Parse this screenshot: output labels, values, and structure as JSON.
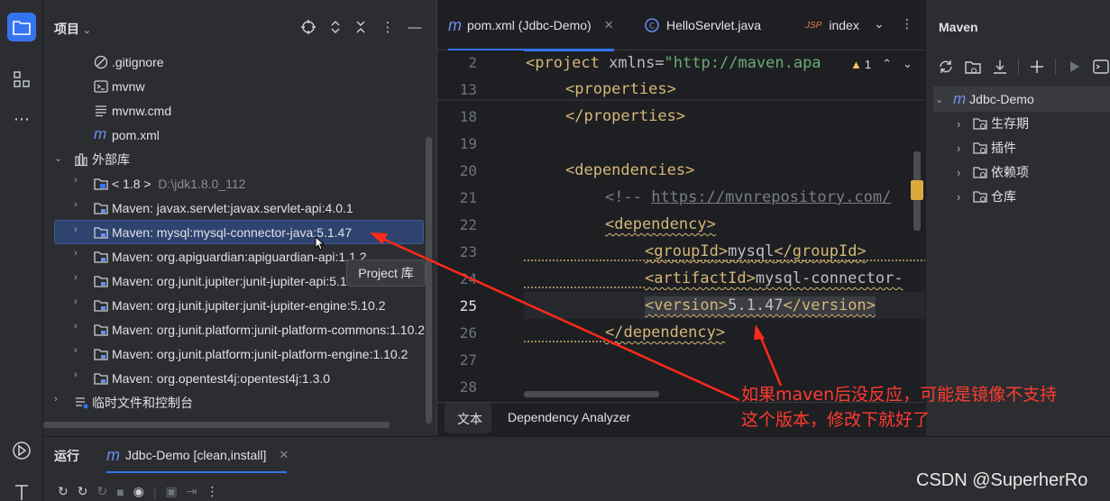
{
  "project_panel": {
    "title": "项目",
    "tree": [
      {
        "label": ".gitignore",
        "icon": "ignore-file-icon"
      },
      {
        "label": "mvnw",
        "icon": "terminal-file-icon"
      },
      {
        "label": "mvnw.cmd",
        "icon": "text-file-icon"
      },
      {
        "label": "pom.xml",
        "icon": "maven-file-icon"
      },
      {
        "label": "外部库",
        "icon": "library-icon"
      },
      {
        "label": "< 1.8 >",
        "path": "D:\\jdk1.8.0_112",
        "icon": "jdk-icon"
      },
      {
        "label": "Maven: javax.servlet:javax.servlet-api:4.0.1",
        "icon": "library-folder-icon"
      },
      {
        "label": "Maven: mysql:mysql-connector-java:5.1.47",
        "icon": "library-folder-icon"
      },
      {
        "label": "Maven: org.apiguardian:apiguardian-api:1.1.2",
        "icon": "library-folder-icon"
      },
      {
        "label": "Maven: org.junit.jupiter:junit-jupiter-api:5.10.2",
        "icon": "library-folder-icon"
      },
      {
        "label": "Maven: org.junit.jupiter:junit-jupiter-engine:5.10.2",
        "icon": "library-folder-icon"
      },
      {
        "label": "Maven: org.junit.platform:junit-platform-commons:1.10.2",
        "icon": "library-folder-icon"
      },
      {
        "label": "Maven: org.junit.platform:junit-platform-engine:1.10.2",
        "icon": "library-folder-icon"
      },
      {
        "label": "Maven: org.opentest4j:opentest4j:1.3.0",
        "icon": "library-folder-icon"
      },
      {
        "label": "临时文件和控制台",
        "icon": "scratches-icon"
      }
    ],
    "tooltip": "Project 库"
  },
  "editor": {
    "tabs": [
      {
        "label": "pom.xml (Jdbc-Demo)",
        "icon": "maven-file-icon"
      },
      {
        "label": "HelloServlet.java",
        "icon": "java-class-icon"
      },
      {
        "label": "index",
        "icon": "jsp-file-icon"
      }
    ],
    "warning_count": "1",
    "line_numbers": [
      "2",
      "13",
      "18",
      "19",
      "20",
      "21",
      "22",
      "23",
      "24",
      "25",
      "26",
      "27",
      "28"
    ],
    "code": {
      "l2_open": "<project ",
      "l2_attr": "xmlns=",
      "l2_str": "\"http://maven.apa",
      "l13": "<properties>",
      "l18": "</properties>",
      "l20": "<dependencies>",
      "l21_a": "<!-- ",
      "l21_b": "https://mvnrepository.com/",
      "l22": "<dependency>",
      "l23_a": "<groupId>",
      "l23_b": "mysql",
      "l23_c": "</groupId>",
      "l24_a": "<artifactId>",
      "l24_b": "mysql-connector-",
      "l25_a": "<version>",
      "l25_b": "5.1.47",
      "l25_c": "</version>",
      "l26": "</dependency>"
    },
    "bottom_tabs": [
      "文本",
      "Dependency Analyzer"
    ]
  },
  "maven_panel": {
    "title": "Maven",
    "tree": [
      {
        "label": "Jdbc-Demo",
        "icon": "maven-project-icon"
      },
      {
        "label": "生存期",
        "icon": "lifecycle-icon"
      },
      {
        "label": "插件",
        "icon": "plugins-icon"
      },
      {
        "label": "依赖项",
        "icon": "dependencies-icon"
      },
      {
        "label": "仓库",
        "icon": "repositories-icon"
      }
    ]
  },
  "run_bar": {
    "title": "运行",
    "tab": "Jdbc-Demo [clean,install]"
  },
  "annotation": {
    "line1": "如果maven后没反应，可能是镜像不支持",
    "line2": "这个版本，修改下就好了"
  },
  "watermark": "CSDN @SuperherRo",
  "colors": {
    "accent": "#3574f0",
    "annotation": "#ff3b30",
    "xml_tag": "#d5b778",
    "string": "#6aab73"
  }
}
